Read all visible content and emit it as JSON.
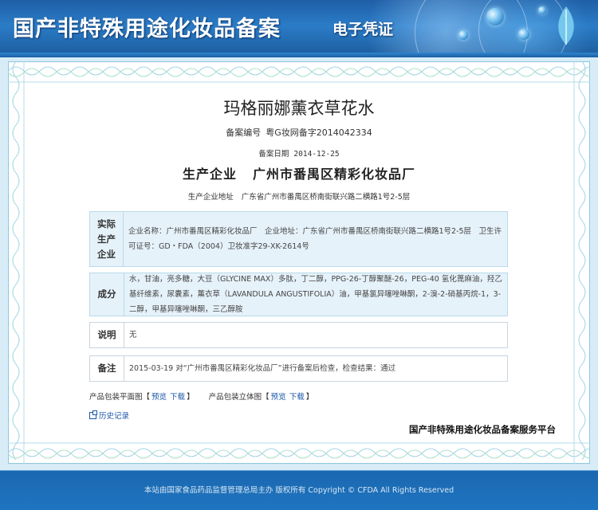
{
  "banner": {
    "title": "国产非特殊用途化妆品备案",
    "subtitle": "电子凭证"
  },
  "product": {
    "name": "玛格丽娜薰衣草花水",
    "record_no_label": "备案编号",
    "record_no": "粤G妆网备字2014042334",
    "record_date_label": "备案日期",
    "record_date": "2014-12-25",
    "company_label": "生产企业",
    "company": "广州市番禺区精彩化妆品厂",
    "address_label": "生产企业地址",
    "address": "广东省广州市番禺区桥南街联兴路二横路1号2-5层"
  },
  "sections": {
    "actual_producer": {
      "label": "实际生产企业",
      "text": "企业名称：广州市番禺区精彩化妆品厂　企业地址：广东省广州市番禺区桥南街联兴路二横路1号2-5层　卫生许可证号：GD・FDA（2004）卫妆准字29-XK-2614号"
    },
    "ingredients": {
      "label": "成分",
      "text": "水，甘油，亮多糖，大豆（GLYCINE MAX）多肽，丁二醇，PPG-26-丁醇聚醚-26，PEG-40 氢化蓖麻油，羟乙基纤维素，尿囊素，薰衣草（LAVANDULA ANGUSTIFOLIA）油，甲基氯异噻唑啉酮，2-溴-2-硝基丙烷-1，3-二醇，甲基异噻唑啉酮，三乙醇胺"
    },
    "explanation": {
      "label": "说明",
      "text": "无"
    },
    "remarks": {
      "label": "备注",
      "text": "2015-03-19 对“广州市番禺区精彩化妆品厂”进行备案后检查，检查结果：通过"
    }
  },
  "packaging": {
    "flat_label": "产品包装平面图",
    "stereo_label": "产品包装立体图",
    "preview": "预览",
    "download": "下载",
    "bracket_open": "【",
    "bracket_close": "】"
  },
  "history_label": "历史记录",
  "platform_label": "国产非特殊用途化妆品备案服务平台",
  "footer": {
    "text": "本站由国家食品药品监督管理总局主办 版权所有 Copyright © CFDA All Rights Reserved"
  }
}
